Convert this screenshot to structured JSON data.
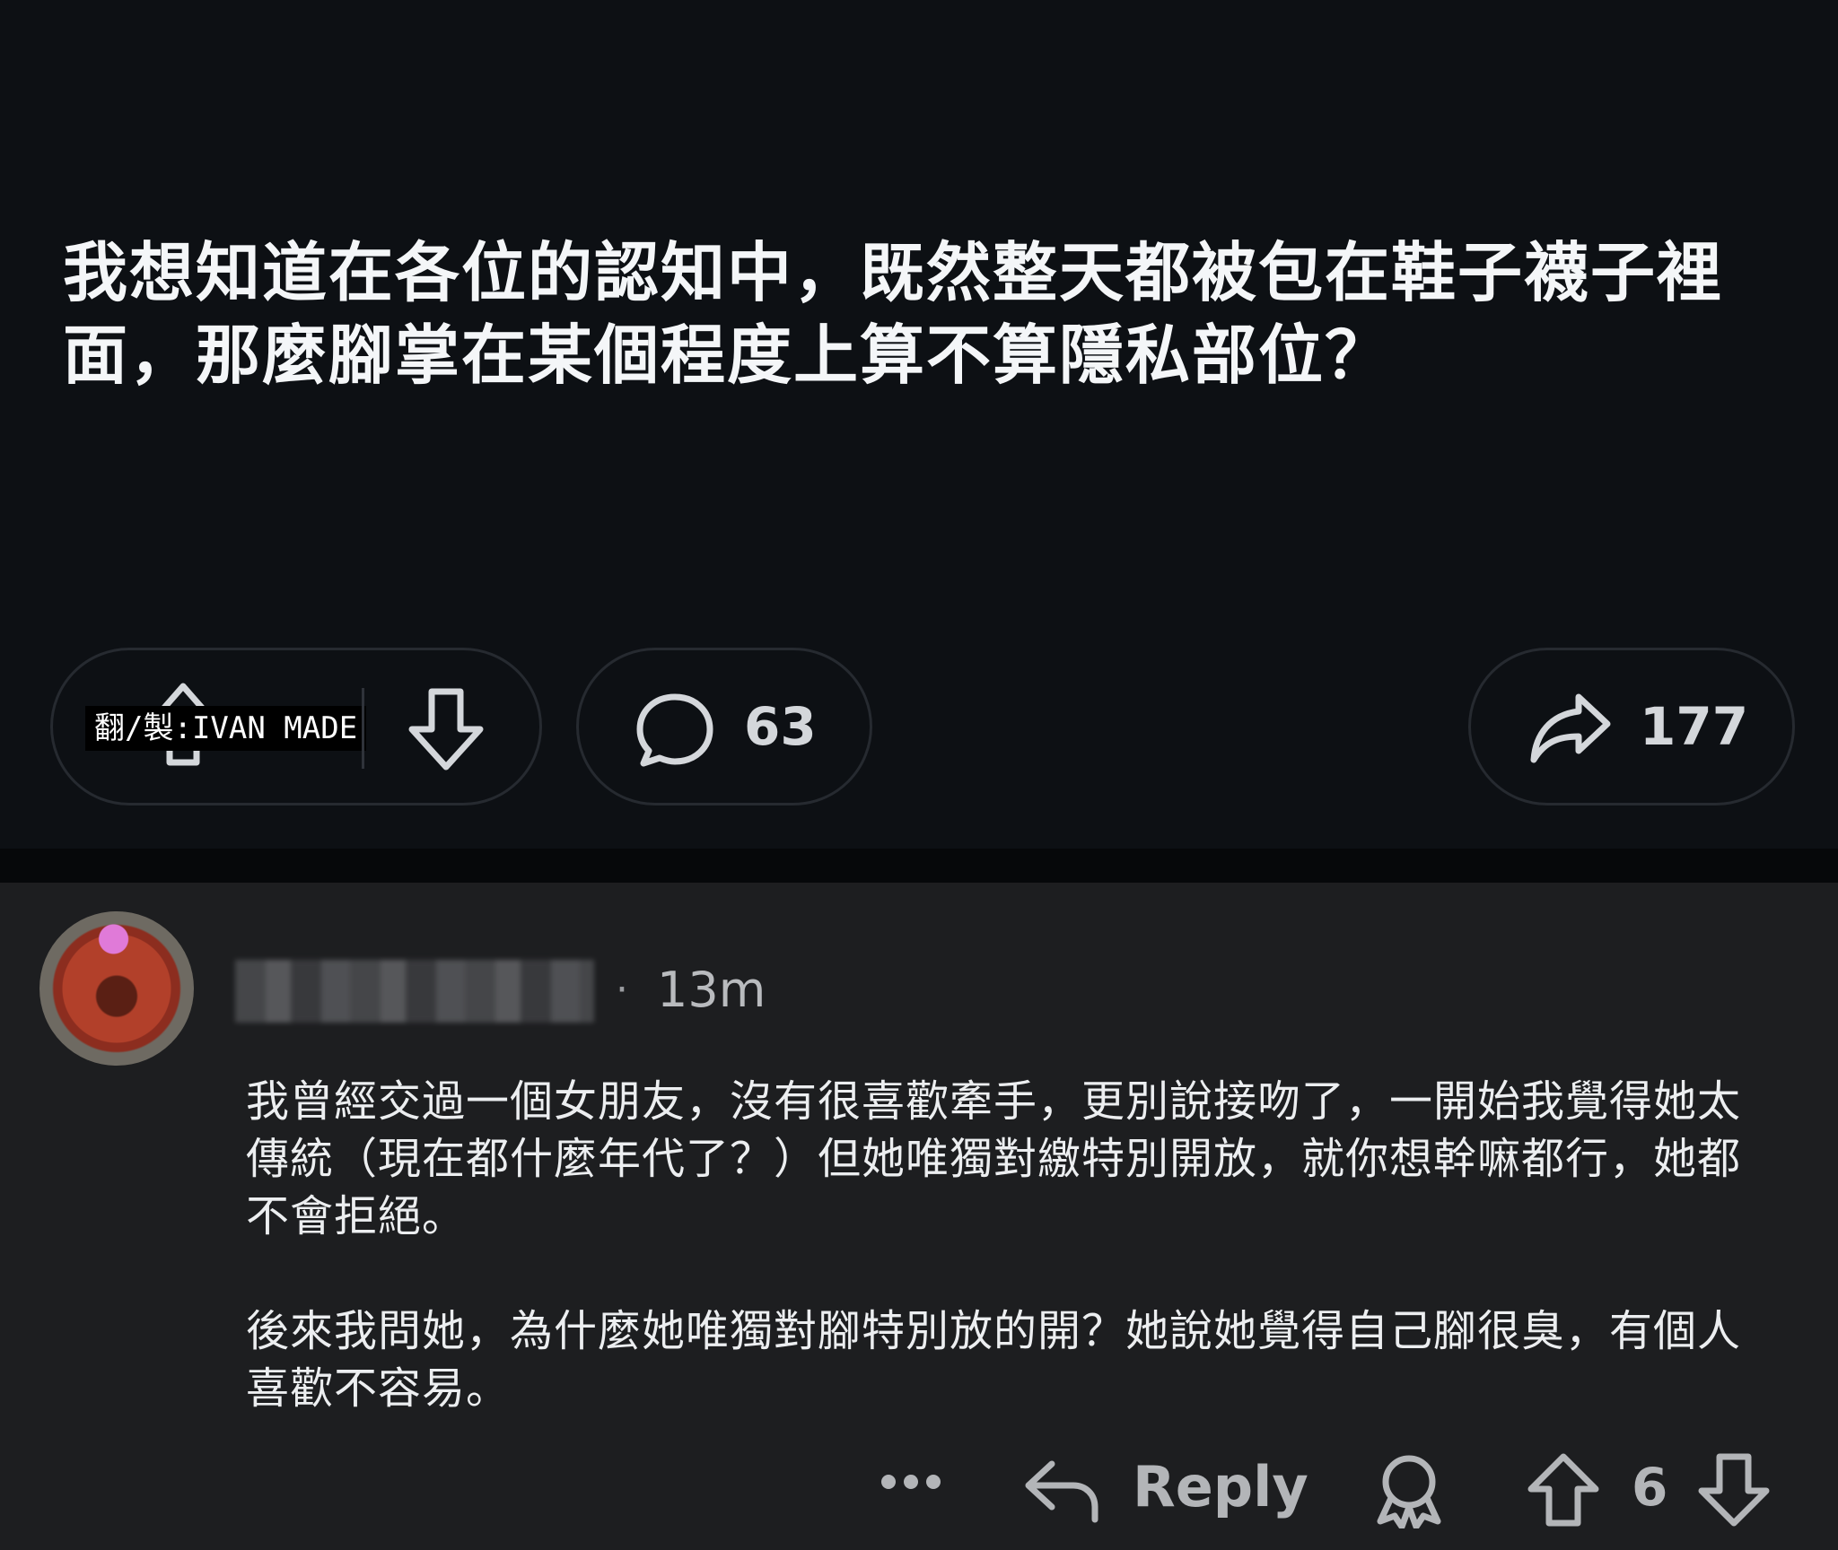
{
  "post": {
    "title": "我想知道在各位的認知中，既然整天都被包在鞋子襪子裡面，那麼腳掌在某個程度上算不算隱私部位？",
    "watermark": "翻/製:IVAN MADE",
    "comment_count": "63",
    "share_count": "177"
  },
  "comment": {
    "username": "",
    "separator": "·",
    "timestamp": "13m",
    "paragraphs": [
      "我曾經交過一個女朋友，沒有很喜歡牽手，更別說接吻了，一開始我覺得她太傳統（現在都什麼年代了？）但她唯獨對繳特別開放，就你想幹嘛都行，她都不會拒絕。",
      "後來我問她，為什麼她唯獨對腳特別放的開？她說她覺得自己腳很臭，有個人喜歡不容易。"
    ],
    "actions": {
      "reply_label": "Reply",
      "score": "6"
    }
  },
  "icons": {
    "upvote": "upvote-arrow-icon",
    "downvote": "downvote-arrow-icon",
    "comment": "speech-bubble-icon",
    "share": "share-arrow-icon",
    "more": "ellipsis-icon",
    "reply": "reply-arrow-icon",
    "award": "award-icon"
  },
  "colors": {
    "post_background": "#0d1014",
    "comment_background": "#1d1e20",
    "text_primary": "#f4f6f8",
    "text_secondary": "#b3b5b8"
  }
}
